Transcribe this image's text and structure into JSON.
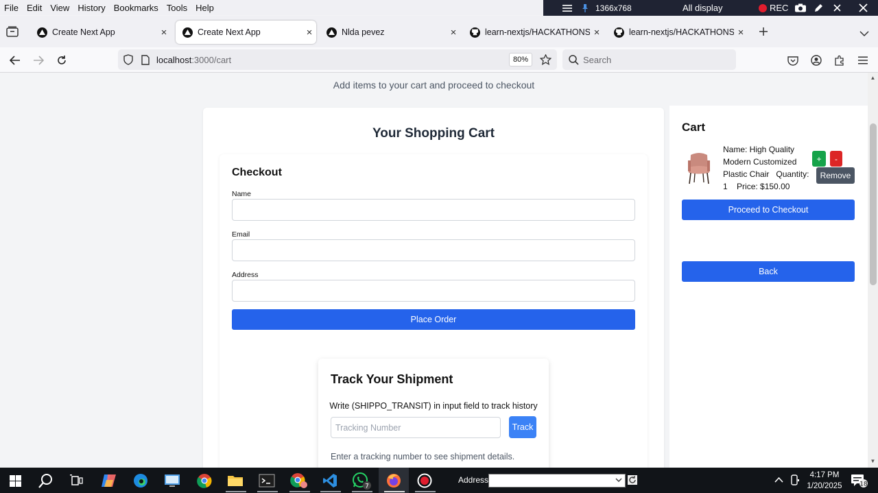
{
  "menu": [
    "File",
    "Edit",
    "View",
    "History",
    "Bookmarks",
    "Tools",
    "Help"
  ],
  "recorder": {
    "resolution": "1366x768",
    "display": "All display",
    "rec": "REC"
  },
  "tabs": [
    {
      "title": "Create Next App",
      "icon": "nextjs-icon"
    },
    {
      "title": "Create Next App",
      "icon": "nextjs-icon",
      "active": true
    },
    {
      "title": "Nlda pevez",
      "icon": "nextjs-icon"
    },
    {
      "title": "learn-nextjs/HACKATHONS/Ma",
      "icon": "github-icon"
    },
    {
      "title": "learn-nextjs/HACKATHONS/Ma",
      "icon": "github-icon"
    }
  ],
  "nav": {
    "url_host": "localhost",
    "url_path": ":3000/cart",
    "zoom": "80%",
    "search_placeholder": "Search"
  },
  "page": {
    "subtitle": "Add items to your cart and proceed to checkout",
    "heading": "Your Shopping Cart",
    "checkout": {
      "title": "Checkout",
      "name_label": "Name",
      "email_label": "Email",
      "address_label": "Address",
      "place_order": "Place Order"
    },
    "tracking": {
      "title": "Track Your Shipment",
      "hint": "Write (SHIPPO_TRANSIT) in input field to track history",
      "placeholder": "Tracking Number",
      "button": "Track",
      "info": "Enter a tracking number to see shipment details."
    },
    "cart": {
      "title": "Cart",
      "item": {
        "name_line": "Name: High Quality Modern Customized Plastic Chair",
        "quantity_label": "Quantity: 1",
        "price_label": "Price: $150.00"
      },
      "plus": "+",
      "minus": "-",
      "tooltip": "Remove",
      "checkout_button": "Proceed to Checkout",
      "back_button": "Back"
    }
  },
  "taskbar": {
    "address_label": "Address",
    "time": "4:17 PM",
    "date": "1/20/2025",
    "notifications": "18",
    "whatsapp_badge": "7"
  },
  "colors": {
    "primary_blue": "#2563eb",
    "track_blue": "#3b82f6",
    "plus_green": "#16a34a",
    "minus_red": "#dc2626"
  }
}
